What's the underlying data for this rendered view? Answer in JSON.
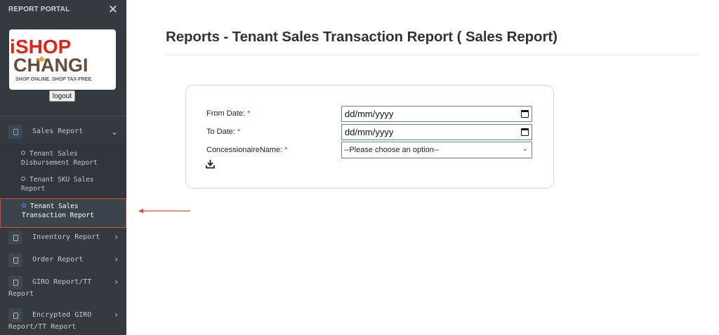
{
  "sidebar": {
    "brand": "REPORT PORTAL",
    "close_glyph": "✕",
    "logo": {
      "line1_i": "i",
      "line1_rest": "SHOP",
      "line2": "CHANGI",
      "tagline": "SHOP ONLINE. SHOP TAX-FREE."
    },
    "logout_label": "logout",
    "menu": {
      "sales_report": "Sales Report",
      "sales_sub": [
        {
          "line1": "Tenant Sales",
          "line2": "Disbursement Report"
        },
        {
          "line1": "Tenant SKU Sales",
          "line2": "Report"
        },
        {
          "line1": "Tenant Sales",
          "line2": "Transaction Report"
        }
      ],
      "inventory_report": "Inventory Report",
      "order_report": "Order Report",
      "giro": {
        "line1": "GIRO Report/TT",
        "line2": "Report"
      },
      "encrypted_giro": {
        "line1": "Encrypted GIRO",
        "line2": "Report/TT Report"
      }
    }
  },
  "main": {
    "title": "Reports - Tenant Sales Transaction Report ( Sales Report)",
    "form": {
      "from_date_label": "From Date:",
      "to_date_label": "To Date:",
      "concessionaire_label": "ConcessionaireName:",
      "required_mark": "*",
      "date_placeholder": "dd/mm/yyyy",
      "select_value": "--Please choose an option--"
    }
  },
  "colors": {
    "sidebar_bg": "#343a40",
    "highlight": "#e04a3a",
    "required": "#d9342b",
    "logo_red": "#e2231a",
    "logo_brown": "#6b4a3a"
  },
  "icons": [
    "close-icon",
    "document-icon",
    "chevron-down-icon",
    "chevron-right-icon",
    "circle-icon",
    "calendar-icon",
    "download-icon",
    "arrow-left-icon"
  ]
}
